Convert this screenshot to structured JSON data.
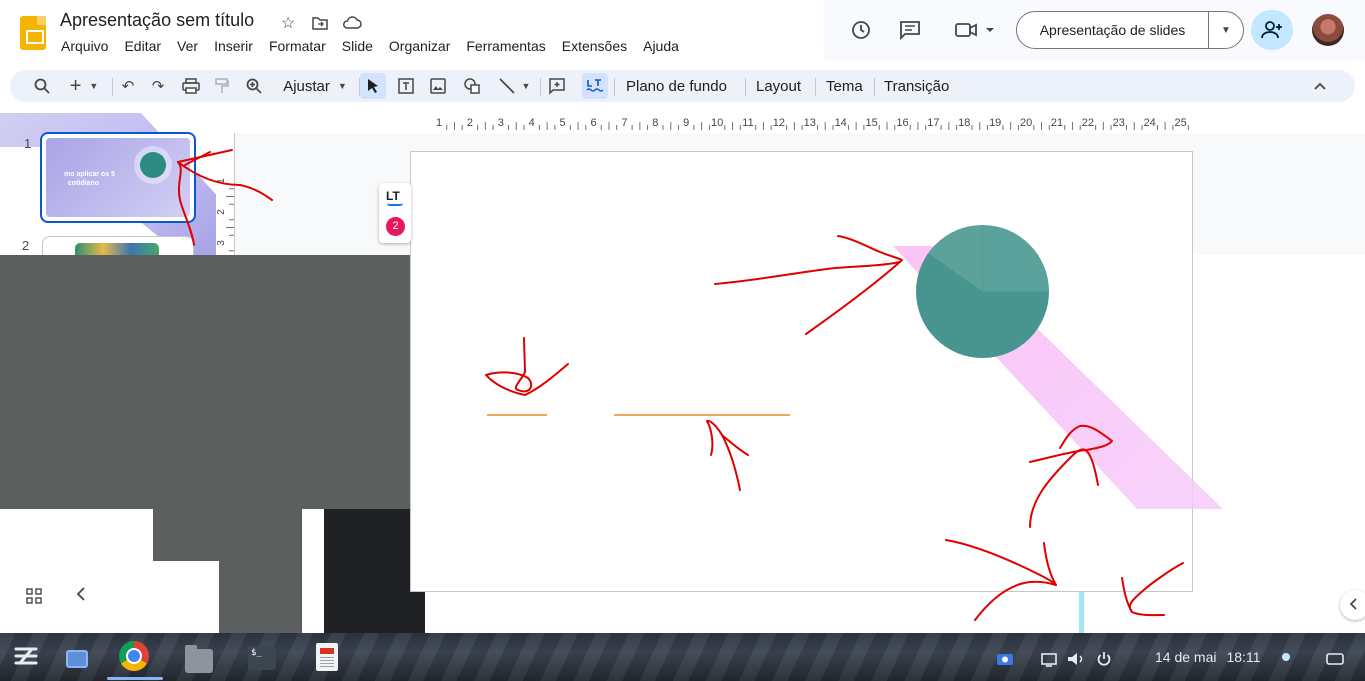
{
  "header": {
    "doc_title": "Apresentação sem título",
    "menu": [
      "Arquivo",
      "Editar",
      "Ver",
      "Inserir",
      "Formatar",
      "Slide",
      "Organizar",
      "Ferramentas",
      "Extensões",
      "Ajuda"
    ],
    "slideshow_label": "Apresentação de slides"
  },
  "toolbar": {
    "zoom_label": "Ajustar",
    "background_label": "Plano de fundo",
    "layout_label": "Layout",
    "theme_label": "Tema",
    "transition_label": "Transição"
  },
  "ruler": {
    "marks": [
      "1",
      "2",
      "3",
      "4",
      "5",
      "6",
      "7",
      "8",
      "9",
      "10",
      "11",
      "12",
      "13",
      "14",
      "15",
      "16",
      "17",
      "18",
      "19",
      "20",
      "21",
      "22",
      "23",
      "24",
      "25"
    ],
    "vertical_marks": [
      "1",
      "2",
      "3"
    ]
  },
  "filmstrip": {
    "slides": [
      {
        "number": "1",
        "thumb_text": "mo aplicar os 5\n  cotidiano"
      },
      {
        "number": "2",
        "thumb_text": ""
      }
    ]
  },
  "languagetool": {
    "logo": "LT",
    "issue_count": "2"
  },
  "taskbar": {
    "date": "14 de mai",
    "time": "18:11"
  },
  "icons": {
    "star": "star-icon",
    "move": "folder-move-icon",
    "cloud": "cloud-icon",
    "history": "history-icon",
    "comments": "comment-icon",
    "meet": "camera-icon",
    "share": "add-person-icon"
  },
  "colors": {
    "accent": "#0b57d0",
    "slides_brand": "#f5b400",
    "pie": "#48948e",
    "annotation": "#e00000"
  }
}
